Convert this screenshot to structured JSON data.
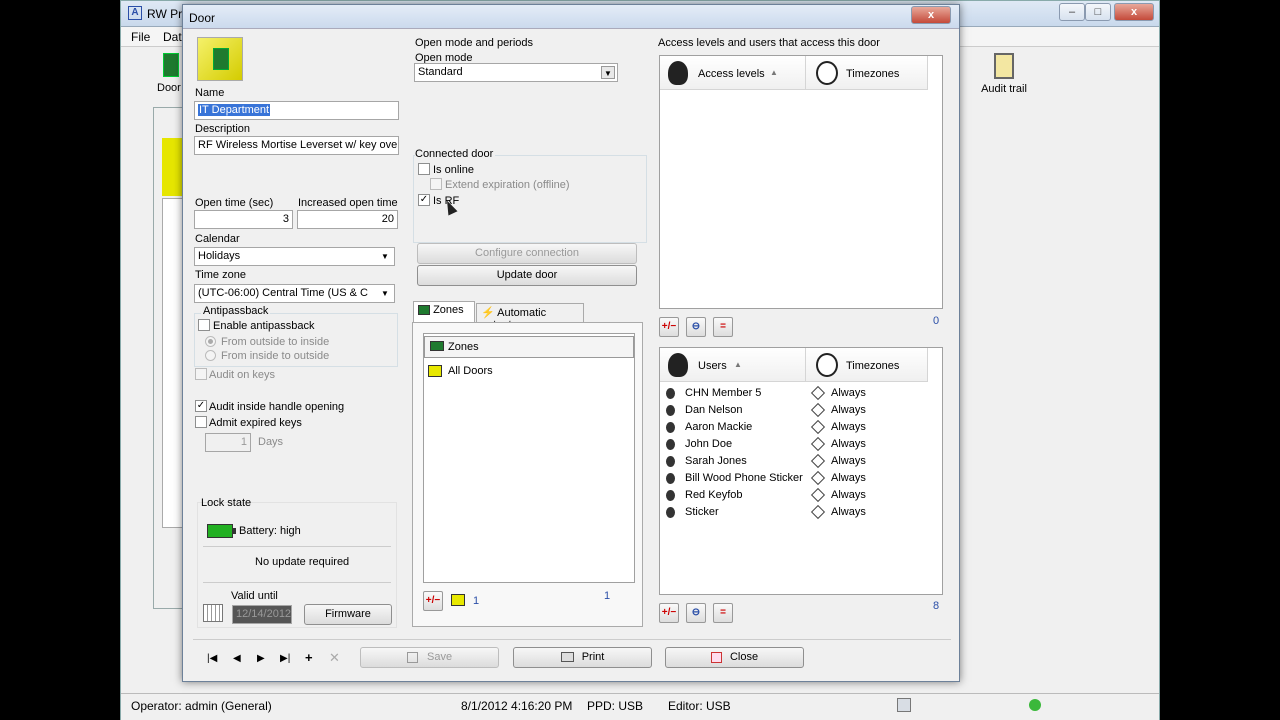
{
  "background_app": {
    "title": "RW Pro",
    "menu": [
      "File",
      "Dat"
    ],
    "toolbar": {
      "doors_label": "Door",
      "audit_trail_label": "Audit trail"
    },
    "status": {
      "operator": "Operator: admin (General)",
      "datetime": "8/1/2012 4:16:20 PM",
      "ppd": "PPD: USB",
      "editor": "Editor: USB"
    }
  },
  "dialog": {
    "title": "Door",
    "close_label": "x",
    "left": {
      "name_label": "Name",
      "name_value": "IT Department",
      "description_label": "Description",
      "description_value": "RF Wireless Mortise Leverset w/ key override",
      "open_time_label": "Open time (sec)",
      "open_time_value": "3",
      "increased_open_time_label": "Increased open time",
      "increased_open_time_value": "20",
      "calendar_label": "Calendar",
      "calendar_value": "Holidays",
      "time_zone_label": "Time zone",
      "time_zone_value": "(UTC-06:00) Central Time (US & C",
      "antipassback_label": "Antipassback",
      "enable_antipassback_label": "Enable antipassback",
      "from_outside_label": "From outside to inside",
      "from_inside_label": "From inside to outside",
      "audit_on_keys_label": "Audit on keys",
      "audit_inside_label": "Audit inside handle opening",
      "admit_expired_label": "Admit expired keys",
      "days_value": "1",
      "days_label": "Days",
      "lock_state_label": "Lock state",
      "battery_label": "Battery: high",
      "no_update_label": "No update required",
      "valid_until_label": "Valid until",
      "valid_until_value": "12/14/2012",
      "firmware_label": "Firmware"
    },
    "middle": {
      "open_mode_group": "Open mode and periods",
      "open_mode_label": "Open mode",
      "open_mode_value": "Standard",
      "connected_door_label": "Connected door",
      "is_online_label": "Is online",
      "extend_expiration_label": "Extend expiration (offline)",
      "is_rf_label": "Is RF",
      "configure_connection_label": "Configure connection",
      "update_door_label": "Update door",
      "tabs": [
        {
          "label": "Zones"
        },
        {
          "label": "Automatic outputs"
        }
      ],
      "zones_header": "Zones",
      "zones": [
        "All Doors"
      ],
      "zones_count_a": "1",
      "zones_count_b": "1"
    },
    "right": {
      "access_title": "Access levels and users that access this door",
      "access_levels_header": "Access levels",
      "timezones_header": "Timezones",
      "access_count": "0",
      "users_header": "Users",
      "users_timezones_header": "Timezones",
      "users": [
        {
          "name": "CHN Member 5",
          "tz": "Always"
        },
        {
          "name": "Dan Nelson",
          "tz": "Always"
        },
        {
          "name": "Aaron Mackie",
          "tz": "Always"
        },
        {
          "name": "John Doe",
          "tz": "Always"
        },
        {
          "name": "Sarah Jones",
          "tz": "Always"
        },
        {
          "name": "Bill Wood Phone Sticker",
          "tz": "Always"
        },
        {
          "name": "Red Keyfob",
          "tz": "Always"
        },
        {
          "name": "Sticker",
          "tz": "Always"
        }
      ],
      "users_count": "8"
    },
    "bottom": {
      "save_label": "Save",
      "print_label": "Print",
      "close_label": "Close"
    }
  },
  "colors": {
    "accent_blue": "#2b4fa8",
    "door_green": "#1f7a2f",
    "battery_green": "#22b022"
  }
}
